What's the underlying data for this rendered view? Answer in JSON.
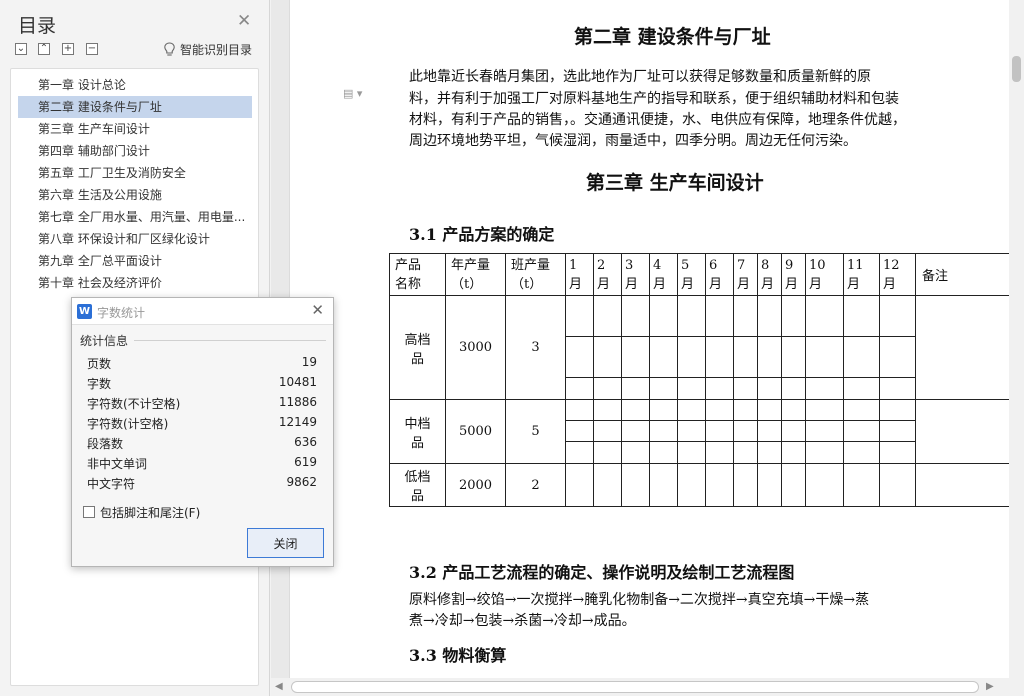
{
  "toc": {
    "title": "目录",
    "smart_label": "智能识别目录",
    "tools": [
      "collapse",
      "expand",
      "add",
      "remove"
    ],
    "items": [
      {
        "label": "第一章  设计总论"
      },
      {
        "label": "第二章  建设条件与厂址",
        "active": true
      },
      {
        "label": "第三章  生产车间设计"
      },
      {
        "label": "第四章  辅助部门设计"
      },
      {
        "label": "第五章  工厂卫生及消防安全"
      },
      {
        "label": "第六章  生活及公用设施"
      },
      {
        "label": "第七章  全厂用水量、用汽量、用电量..."
      },
      {
        "label": "第八章  环保设计和厂区绿化设计"
      },
      {
        "label": "第九章  全厂总平面设计"
      },
      {
        "label": "第十章  社会及经济评价"
      }
    ]
  },
  "word_count": {
    "title": "字数统计",
    "section": "统计信息",
    "rows": [
      {
        "label": "页数",
        "value": "19"
      },
      {
        "label": "字数",
        "value": "10481"
      },
      {
        "label": "字符数(不计空格)",
        "value": "11886"
      },
      {
        "label": "字符数(计空格)",
        "value": "12149"
      },
      {
        "label": "段落数",
        "value": "636"
      },
      {
        "label": "非中文单词",
        "value": "619"
      },
      {
        "label": "中文字符",
        "value": "9862"
      }
    ],
    "checkbox_label": "包括脚注和尾注(F)",
    "checkbox_checked": false,
    "close_button": "关闭"
  },
  "document": {
    "chapter2_title": "第二章  建设条件与厂址",
    "chapter2_lines": [
      "    此地靠近长春皓月集团，选此地作为厂址可以获得足够数量和质量新鲜的原",
      "料，并有利于加强工厂对原料基地生产的指导和联系，便于组织辅助材料和包装",
      "材料，有利于产品的销售，。交通通讯便捷，水、电供应有保障，地理条件优越，",
      "周边环境地势平坦，气候湿润，雨量适中，四季分明。周边无任何污染。"
    ],
    "chapter3_title": "第三章  生产车间设计",
    "section31": "3.1  产品方案的确定",
    "table": {
      "header": {
        "product": [
          "产品",
          "名称"
        ],
        "annual": [
          "年产量",
          "（t）"
        ],
        "shift": [
          "班产量",
          "（t）"
        ],
        "months": [
          [
            "1",
            "月"
          ],
          [
            "2",
            "月"
          ],
          [
            "3",
            "月"
          ],
          [
            "4",
            "月"
          ],
          [
            "5",
            "月"
          ],
          [
            "6",
            "月"
          ],
          [
            "7",
            "月"
          ],
          [
            "8",
            "月"
          ],
          [
            "9",
            "月"
          ],
          [
            "10",
            "月"
          ],
          [
            "11",
            "月"
          ],
          [
            "12",
            "月"
          ]
        ],
        "note": "备注"
      },
      "products": [
        {
          "name": [
            "高档",
            "品"
          ],
          "annual": "3000",
          "shift": "3"
        },
        {
          "name": [
            "中档",
            "品"
          ],
          "annual": "5000",
          "shift": "5"
        },
        {
          "name": [
            "低档",
            "品"
          ],
          "annual": "2000",
          "shift": "2"
        }
      ]
    },
    "section32": "3.2  产品工艺流程的确定、操作说明及绘制工艺流程图",
    "section32_lines": [
      "原料修割→绞馅→一次搅拌→腌乳化物制备→二次搅拌→真空充填→干燥→蒸",
      "煮→冷却→包装→杀菌→冷却→成品。"
    ],
    "section33": "3.3  物料衡算"
  },
  "colors": {
    "toc_active": "#c5d5ec",
    "dialog_accent": "#3d7ad6",
    "app_logo": "#2b6fd6"
  }
}
